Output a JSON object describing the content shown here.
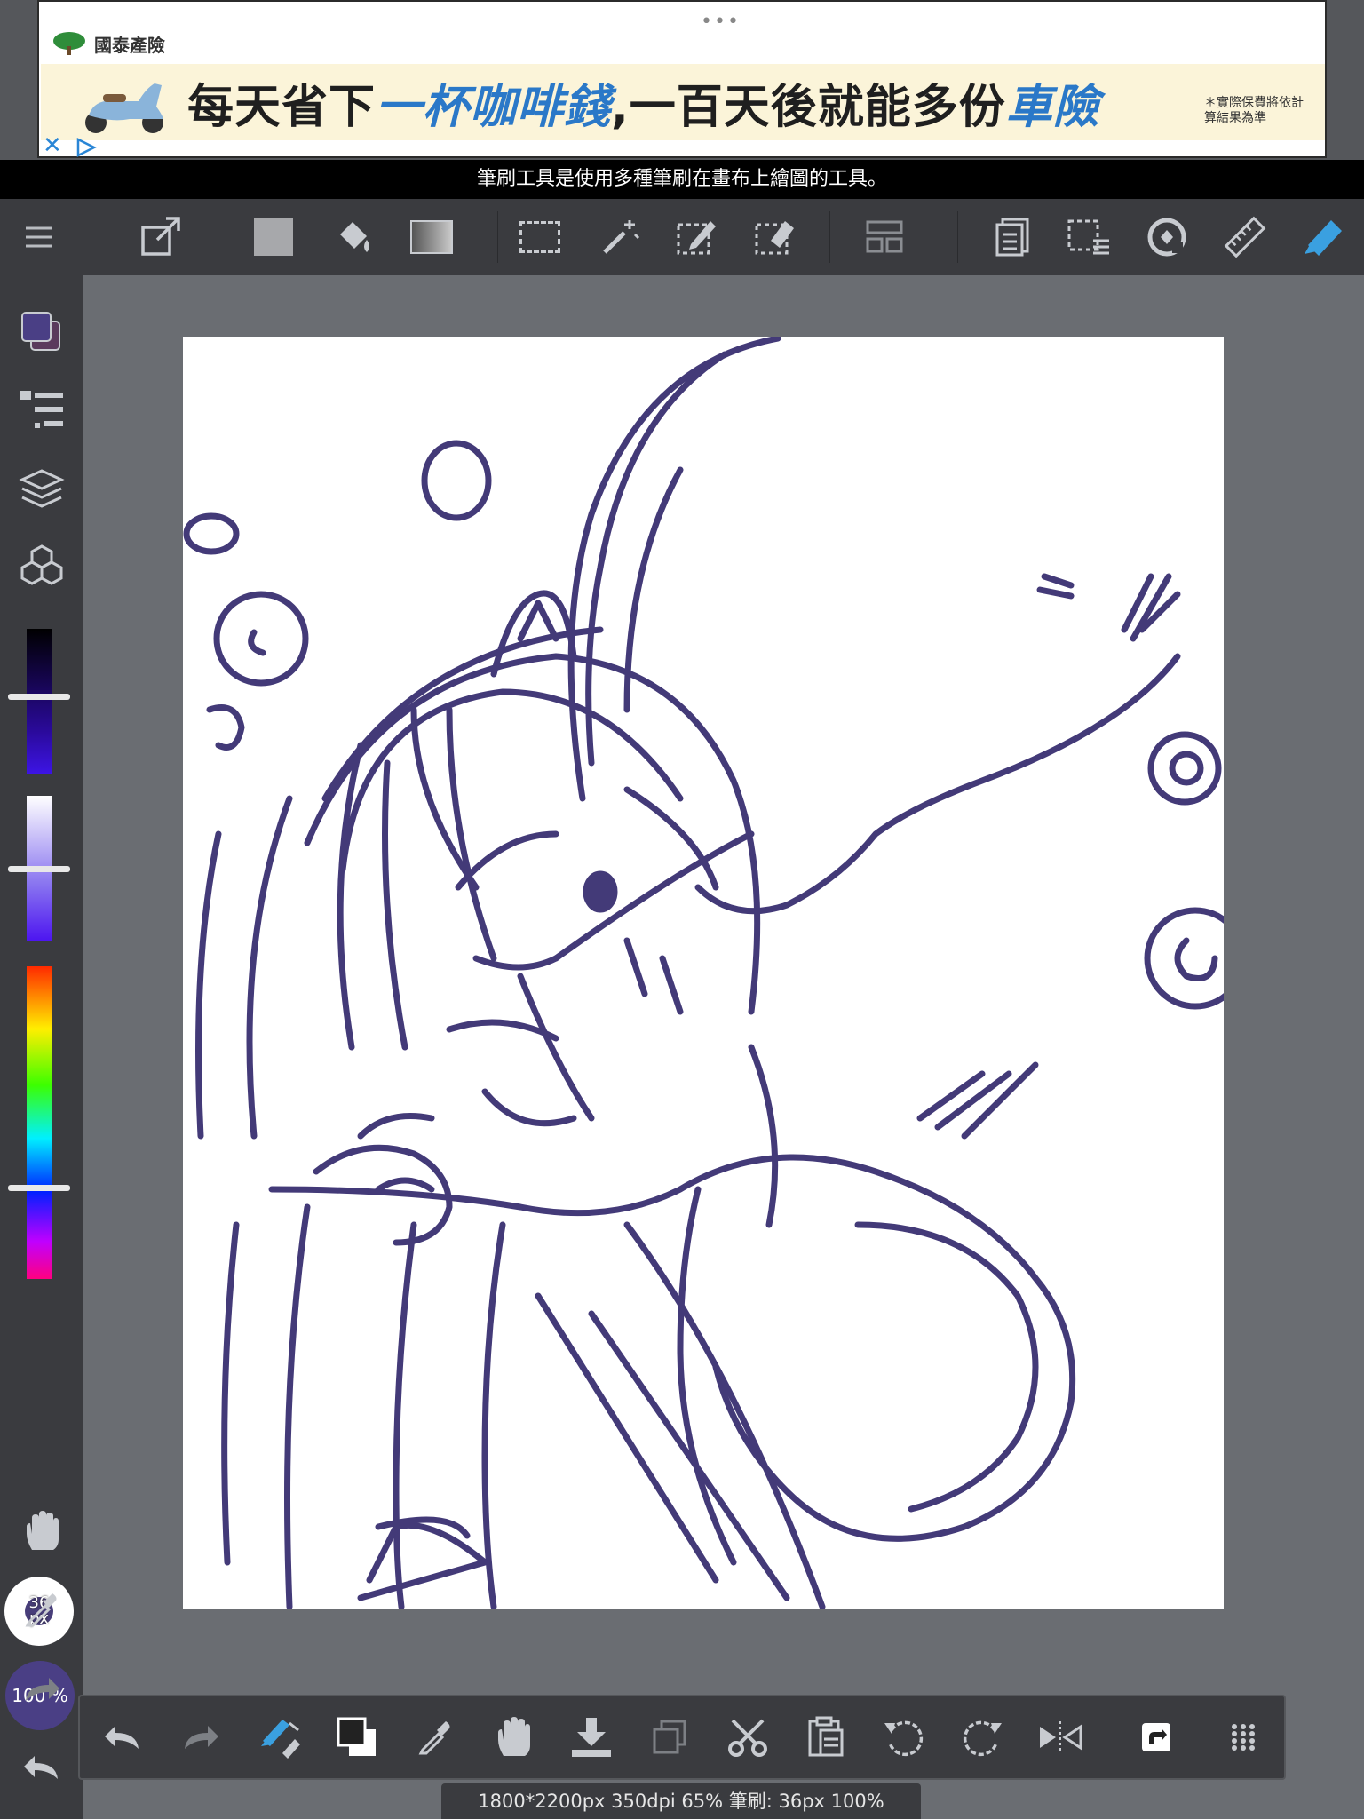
{
  "ad": {
    "brand": "國泰產險",
    "headline_part1": "每天省下",
    "headline_highlight1": "一杯咖啡錢",
    "headline_part2": ",一百天後就能多份",
    "headline_highlight2": "車險",
    "fine_print": "＊實際保費將依計算結果為準",
    "close_symbol": "✕",
    "menu_dots": "•••"
  },
  "tip": "筆刷工具是使用多種筆刷在畫布上繪圖的工具。",
  "top_toolbar": {
    "icons": [
      "menu-icon",
      "export-icon",
      "fill-color-icon",
      "bucket-icon",
      "gradient-icon",
      "select-rect-icon",
      "magic-wand-icon",
      "select-pen-icon",
      "select-eraser-icon",
      "layout-icon",
      "document-icon",
      "selection-list-icon",
      "snap-icon",
      "ruler-icon",
      "pen-brush-icon"
    ]
  },
  "left_panel": {
    "main_color": "#4a3f85",
    "sub_color": "#5a3a5c",
    "brush_size_label": "36 px",
    "opacity_label": "100 %"
  },
  "bottom_toolbar": {
    "icons": [
      "undo-icon",
      "redo-icon",
      "brush-eraser-toggle-icon",
      "color-swap-icon",
      "eyedropper-icon",
      "hand-icon",
      "import-icon",
      "copy-icon",
      "cut-icon",
      "paste-icon",
      "rotate-ccw-icon",
      "rotate-cw-icon",
      "flip-icon",
      "open-icon",
      "more-grid-icon"
    ]
  },
  "status": "1800*2200px 350dpi 65% 筆刷: 36px 100%",
  "colors": {
    "stroke": "#433a78",
    "panel": "#3a3b3f",
    "workspace": "#6a6d72",
    "accent": "#3aa0e0"
  }
}
